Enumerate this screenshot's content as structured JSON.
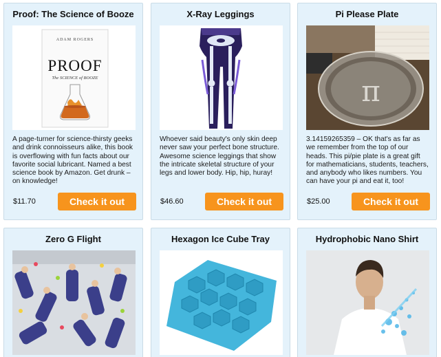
{
  "products": [
    {
      "title": "Proof: The Science of Booze",
      "description": "A page-turner for science-thirsty geeks and drink connoisseurs alike, this book is overflowing with fun facts about our favorite social lubricant. Named a best science book by Amazon. Get drunk – on knowledge!",
      "price": "$11.70",
      "button_label": "Check it out",
      "image": {
        "type": "book-cover",
        "author_text": "ADAM ROGERS",
        "title_text": "PROOF",
        "subtitle_text": "The SCIENCE of BOOZE"
      }
    },
    {
      "title": "X-Ray Leggings",
      "description": "Whoever said beauty's only skin deep never saw your perfect bone structure. Awesome science leggings that show the intricate skeletal structure of your legs and lower body. Hip, hip, huray!",
      "price": "$46.60",
      "button_label": "Check it out",
      "image": {
        "type": "leggings-photo"
      }
    },
    {
      "title": "Pi Please Plate",
      "description": "3.14159265359 – OK that's as far as we remember from the top of our heads. This pi/pie plate is a great gift for mathematicians, students, teachers, and anybody who likes numbers. You can have your pi and eat it, too!",
      "price": "$25.00",
      "button_label": "Check it out",
      "image": {
        "type": "pie-plate-photo"
      }
    },
    {
      "title": "Zero G Flight",
      "image": {
        "type": "zero-g-photo"
      }
    },
    {
      "title": "Hexagon Ice Cube Tray",
      "image": {
        "type": "ice-tray-photo"
      }
    },
    {
      "title": "Hydrophobic Nano Shirt",
      "image": {
        "type": "nano-shirt-photo"
      }
    }
  ],
  "colors": {
    "card_background": "#e4f2fb",
    "card_border": "#c9dbe6",
    "button": "#f7941d",
    "button_text": "#ffffff"
  }
}
